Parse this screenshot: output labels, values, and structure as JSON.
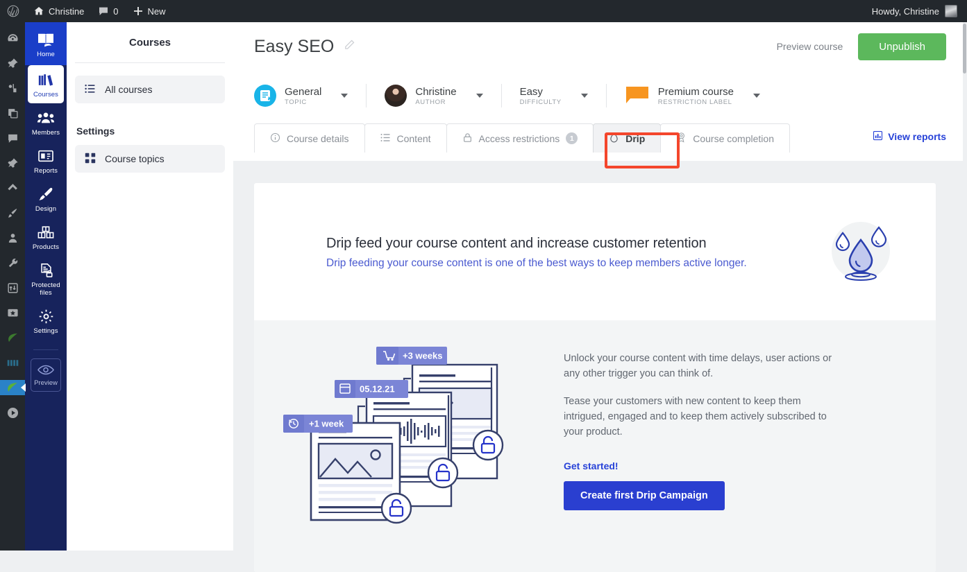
{
  "adminbar": {
    "wp_logo_icon": "wordpress-icon",
    "site_icon": "home-icon",
    "site_name": "Christine",
    "comments_icon": "comment-bubble-icon",
    "comments_count": "0",
    "new_icon": "plus-icon",
    "new_label": "New",
    "howdy": "Howdy, Christine",
    "avatar_icon": "user-avatar"
  },
  "wp_rail": {
    "items": [
      {
        "name": "dashboard-icon"
      },
      {
        "name": "pin-icon"
      },
      {
        "name": "media-icon"
      },
      {
        "name": "pages-icon"
      },
      {
        "name": "comments-icon"
      },
      {
        "name": "pin-alt-icon"
      },
      {
        "name": "plugin-icon"
      },
      {
        "name": "brush-icon"
      },
      {
        "name": "users-icon"
      },
      {
        "name": "tools-icon"
      },
      {
        "name": "sliders-icon"
      },
      {
        "name": "star-box-icon"
      },
      {
        "name": "leaf-icon"
      },
      {
        "name": "bars-icon"
      },
      {
        "name": "leaf-active-icon"
      },
      {
        "name": "play-icon"
      }
    ]
  },
  "mp_nav": {
    "items": [
      {
        "label": "Home",
        "icon": "book-open-icon",
        "state": "home"
      },
      {
        "label": "Courses",
        "icon": "books-icon",
        "state": "active"
      },
      {
        "label": "Members",
        "icon": "people-icon",
        "state": ""
      },
      {
        "label": "Reports",
        "icon": "report-icon",
        "state": ""
      },
      {
        "label": "Design",
        "icon": "paintbrush-icon",
        "state": ""
      },
      {
        "label": "Products",
        "icon": "boxes-icon",
        "state": ""
      },
      {
        "label": "Protected files",
        "icon": "file-lock-icon",
        "state": ""
      },
      {
        "label": "Settings",
        "icon": "gear-icon",
        "state": ""
      }
    ],
    "preview": {
      "label": "Preview",
      "icon": "eye-icon"
    }
  },
  "sidebar": {
    "title": "Courses",
    "links": [
      {
        "label": "All courses",
        "icon": "list-icon",
        "active": true
      }
    ],
    "section_label": "Settings",
    "settings_links": [
      {
        "label": "Course topics",
        "icon": "grid-icon",
        "active": true
      }
    ]
  },
  "header": {
    "title": "Easy SEO",
    "edit_icon": "pencil-icon",
    "preview_label": "Preview course",
    "publish_label": "Unpublish"
  },
  "meta": [
    {
      "value": "General",
      "label": "TOPIC",
      "icon": "topic-badge-icon"
    },
    {
      "value": "Christine",
      "label": "AUTHOR",
      "icon": "author-avatar"
    },
    {
      "value": "Easy",
      "label": "DIFFICULTY",
      "icon": ""
    },
    {
      "value": "Premium course",
      "label": "RESTRICTION LABEL",
      "icon": "restriction-flag-icon"
    }
  ],
  "tabs": [
    {
      "label": "Course details",
      "icon": "info-circle-icon",
      "badge": "",
      "selected": false
    },
    {
      "label": "Content",
      "icon": "list-icon",
      "badge": "",
      "selected": false
    },
    {
      "label": "Access restrictions",
      "icon": "lock-icon",
      "badge": "1",
      "selected": false
    },
    {
      "label": "Drip",
      "icon": "droplet-icon",
      "badge": "",
      "selected": true
    },
    {
      "label": "Course completion",
      "icon": "award-icon",
      "badge": "",
      "selected": false
    }
  ],
  "view_reports": {
    "label": "View reports",
    "icon": "chart-icon"
  },
  "promo": {
    "heading": "Drip feed your course content and increase customer retention",
    "subheading": "Drip feeding your course content is one of the best ways to keep members active longer.",
    "drops_icon": "water-drops-illustration",
    "illustration": {
      "name": "drip-content-illustration",
      "badges": [
        {
          "text": "+3 weeks",
          "icon": "cart-icon"
        },
        {
          "text": "05.12.21",
          "icon": "calendar-icon"
        },
        {
          "text": "+1 week",
          "icon": "clock-rewind-icon"
        }
      ],
      "locks": [
        "unlock-icon",
        "unlock-icon",
        "unlock-icon"
      ]
    },
    "paragraphs": [
      "Unlock your course content with time delays, user actions or any other trigger you can think of.",
      "Tease your customers with new content to keep them intrigued, engaged and to keep them actively subscribed to your product."
    ],
    "get_started": "Get started!",
    "cta_label": "Create first Drip Campaign"
  },
  "colors": {
    "brand_blue": "#2a3fd0",
    "nav_navy": "#17235c",
    "green": "#5cb85c",
    "highlight_red": "#f4462c",
    "link_blue": "#2742d8",
    "badge_purple": "#7b85d6"
  }
}
